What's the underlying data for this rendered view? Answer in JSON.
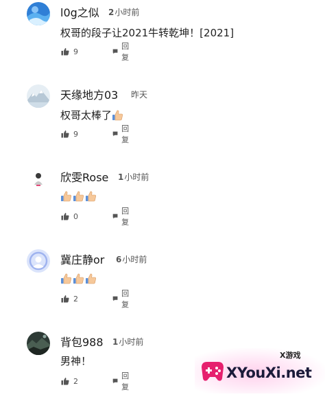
{
  "comments": [
    {
      "user": "l0g之似",
      "time_num": "2",
      "time_unit": "小时前",
      "text": "权哥的段子让2021牛转乾坤！[2021]",
      "likes": "9",
      "reply_label": "回复",
      "avatar_icon": "blue-swirl-avatar",
      "emoji_count": 0
    },
    {
      "user": "天缘地方03",
      "time_num": "",
      "time_unit": "昨天",
      "text": "权哥太棒了",
      "likes": "9",
      "reply_label": "回复",
      "avatar_icon": "snowy-mountain-avatar",
      "emoji_count": 1
    },
    {
      "user": "欣雯Rose",
      "time_num": "1",
      "time_unit": "小时前",
      "text": "",
      "likes": "0",
      "reply_label": "回复",
      "avatar_icon": "small-figure-avatar",
      "emoji_count": 3
    },
    {
      "user": "冀庄静or",
      "time_num": "6",
      "time_unit": "小时前",
      "text": "",
      "likes": "2",
      "reply_label": "回复",
      "avatar_icon": "default-user-avatar",
      "emoji_count": 3
    },
    {
      "user": "背包988",
      "time_num": "1",
      "time_unit": "小时前",
      "text": "男神！",
      "likes": "2",
      "reply_label": "回复",
      "avatar_icon": "landscape-avatar",
      "emoji_count": 0
    }
  ],
  "watermark": {
    "top_text": "X游戏",
    "main_text": "XYouXi.net",
    "icon": "gamepad-logo"
  },
  "colors": {
    "text": "#222222",
    "muted": "#555555",
    "watermark_pink": "#e6206e"
  }
}
